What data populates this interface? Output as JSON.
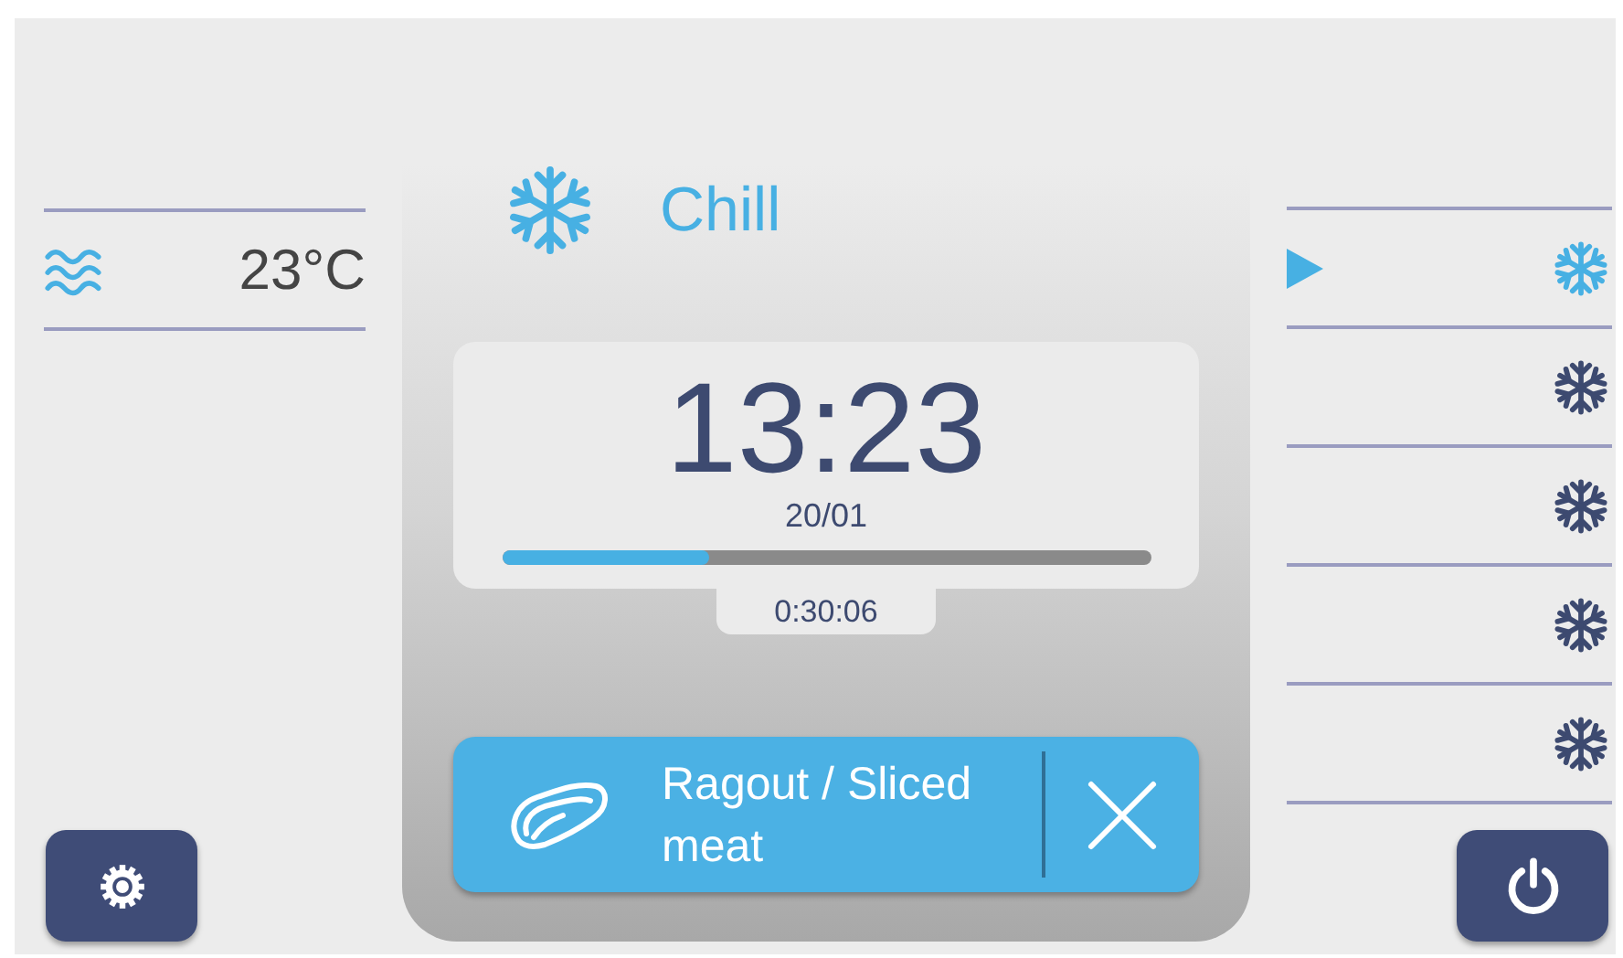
{
  "ambient": {
    "temperature": "23°C"
  },
  "mode": {
    "kind": "chill",
    "label": "Chill"
  },
  "clock": {
    "time": "13:23",
    "date": "20/01"
  },
  "progress": {
    "level": 0.32,
    "remaining": "0:30:06"
  },
  "program": {
    "kind": "meat",
    "label": "Ragout / Sliced meat"
  },
  "stages": [
    {
      "kind": "chill",
      "selected": true
    },
    {
      "kind": "chill",
      "selected": false
    },
    {
      "kind": "chill",
      "selected": false
    },
    {
      "kind": "chill",
      "selected": false
    },
    {
      "kind": "chill",
      "selected": false
    }
  ]
}
